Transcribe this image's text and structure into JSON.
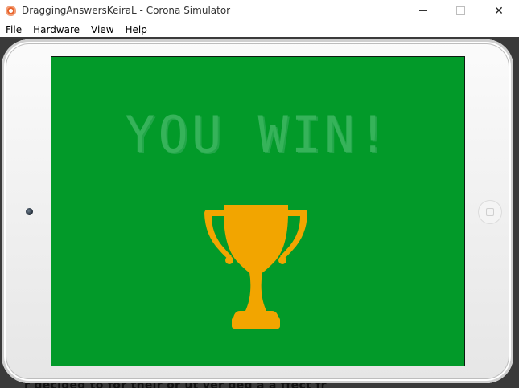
{
  "window": {
    "title": "DraggingAnswersKeiraL - Corona Simulator",
    "controls": {
      "minimize_icon": "minimize-icon",
      "maximize_icon": "maximize-icon",
      "close_label": "✕"
    }
  },
  "menu": {
    "items": [
      {
        "label": "File"
      },
      {
        "label": "Hardware"
      },
      {
        "label": "View"
      },
      {
        "label": "Help"
      }
    ]
  },
  "simulator": {
    "device": "tablet-landscape",
    "screen": {
      "background_color": "#029a29",
      "message": "YOU WIN!",
      "message_color": "#36b35a",
      "trophy_icon": "trophy-icon",
      "trophy_color": "#f2a500"
    },
    "background_text": "r decided to for their or ut ver ded a a ffect fr"
  },
  "colors": {
    "screen_green": "#029a29",
    "trophy_gold": "#f2a500",
    "text_green": "#36b35a"
  }
}
